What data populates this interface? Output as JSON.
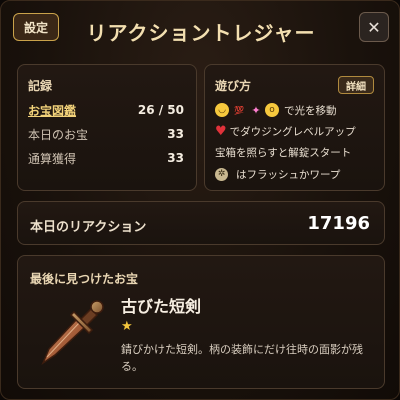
{
  "header": {
    "settings_label": "設定",
    "title": "リアクショントレジャー",
    "close_label": "✕"
  },
  "record": {
    "title": "記録",
    "rows": [
      {
        "label": "お宝図鑑",
        "value": "26 / 50"
      },
      {
        "label": "本日のお宝",
        "value": "33"
      },
      {
        "label": "通算獲得",
        "value": "33"
      }
    ]
  },
  "howto": {
    "title": "遊び方",
    "detail_label": "詳細",
    "line1_text": "で光を移動",
    "line2_text": "でダウジングレベルアップ",
    "line3_text": "宝箱を照らすと解錠スタート",
    "line4_text": "はフラッシュかワープ",
    "emojis": [
      "smile-emoji",
      "hundred-emoji",
      "party-popper-emoji",
      "surprised-emoji",
      "heart-emoji",
      "flash-icon"
    ]
  },
  "reactions": {
    "label": "本日のリアクション",
    "value": "17196"
  },
  "last_treasure": {
    "title": "最後に見つけたお宝",
    "name": "古びた短剣",
    "rarity_stars": "★",
    "description": "錆びかけた短剣。柄の装飾にだけ往時の面影が残る。",
    "icon": "dagger-icon"
  },
  "colors": {
    "accent_gold": "#c9a24a",
    "title_gold": "#f3dfb0",
    "star_gold": "#f2c53d",
    "heart_red": "#e0323a",
    "background": "#1a120c"
  }
}
